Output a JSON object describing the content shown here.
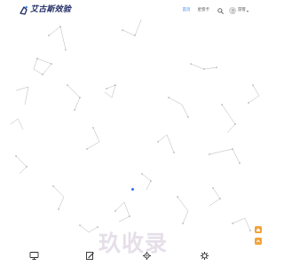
{
  "header": {
    "logo_text": "艾古斯效验",
    "nav": [
      {
        "label": "首页",
        "active": true
      },
      {
        "label": "星悠卡",
        "active": false
      }
    ],
    "user_name": "游客",
    "accent_color": "#2f80ed"
  },
  "watermark": "玖收录",
  "icons": {
    "logo": "logo-mark-icon",
    "search": "search-icon",
    "avatar": "user-avatar-icon",
    "dock": [
      "monitor-icon",
      "edit-icon",
      "gear-icon",
      "settings-icon"
    ],
    "side": [
      "home-icon",
      "top-icon"
    ]
  }
}
